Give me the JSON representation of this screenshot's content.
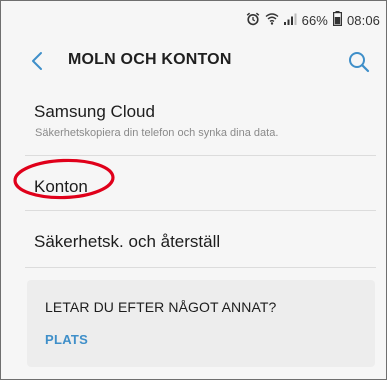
{
  "status_bar": {
    "battery_text": "66%",
    "time": "08:06",
    "icons": [
      "alarm-icon",
      "wifi-icon",
      "signal-icon",
      "battery-icon"
    ]
  },
  "header": {
    "title": "MOLN OCH KONTON",
    "back_icon": "chevron-left-icon",
    "search_icon": "search-icon"
  },
  "items": [
    {
      "title": "Samsung Cloud",
      "subtitle": "Säkerhetskopiera din telefon och synka dina data."
    },
    {
      "title": "Konton",
      "highlight_color": "#e0001a"
    },
    {
      "title": "Säkerhetsk. och återställ"
    }
  ],
  "card": {
    "title": "LETAR DU EFTER NÅGOT ANNAT?",
    "link": "PLATS"
  },
  "colors": {
    "accent": "#3f8fc9",
    "background": "#f6f6f6",
    "card_background": "#ededed",
    "highlight": "#e0001a"
  }
}
